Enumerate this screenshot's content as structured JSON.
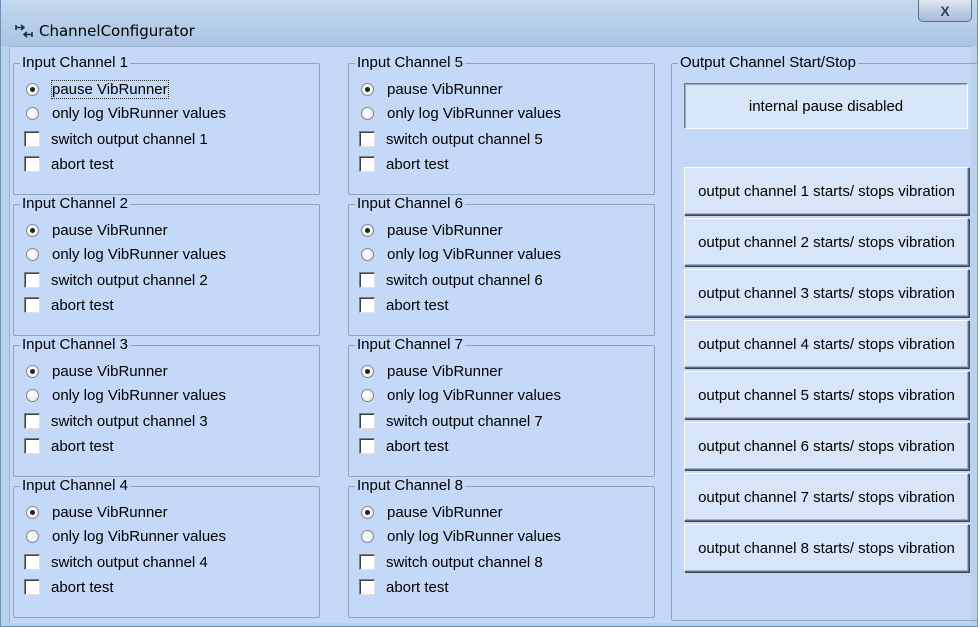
{
  "window": {
    "title": "ChannelConfigurator",
    "close_label": "X"
  },
  "input_channels": [
    {
      "title": "Input Channel 1",
      "pause": "pause VibRunner",
      "log": "only log VibRunner values",
      "switch": "switch output channel 1",
      "abort": "abort test",
      "selected": "pause",
      "switch_checked": false,
      "abort_checked": false
    },
    {
      "title": "Input Channel 2",
      "pause": "pause VibRunner",
      "log": "only log VibRunner values",
      "switch": "switch output channel 2",
      "abort": "abort test",
      "selected": "pause",
      "switch_checked": false,
      "abort_checked": false
    },
    {
      "title": "Input Channel 3",
      "pause": "pause VibRunner",
      "log": "only log VibRunner values",
      "switch": "switch output channel 3",
      "abort": "abort test",
      "selected": "pause",
      "switch_checked": false,
      "abort_checked": false
    },
    {
      "title": "Input Channel 4",
      "pause": "pause VibRunner",
      "log": "only log VibRunner values",
      "switch": "switch output channel 4",
      "abort": "abort test",
      "selected": "pause",
      "switch_checked": false,
      "abort_checked": false
    },
    {
      "title": "Input Channel 5",
      "pause": "pause VibRunner",
      "log": "only log VibRunner values",
      "switch": "switch output channel 5",
      "abort": "abort test",
      "selected": "pause",
      "switch_checked": false,
      "abort_checked": false
    },
    {
      "title": "Input Channel 6",
      "pause": "pause VibRunner",
      "log": "only log VibRunner values",
      "switch": "switch output channel 6",
      "abort": "abort test",
      "selected": "pause",
      "switch_checked": false,
      "abort_checked": false
    },
    {
      "title": "Input Channel 7",
      "pause": "pause VibRunner",
      "log": "only log VibRunner values",
      "switch": "switch output channel 7",
      "abort": "abort test",
      "selected": "pause",
      "switch_checked": false,
      "abort_checked": false
    },
    {
      "title": "Input Channel 8",
      "pause": "pause VibRunner",
      "log": "only log VibRunner values",
      "switch": "switch output channel 8",
      "abort": "abort test",
      "selected": "pause",
      "switch_checked": false,
      "abort_checked": false
    }
  ],
  "output_group": {
    "title": "Output Channel Start/Stop",
    "status": "internal pause disabled",
    "buttons": [
      "output channel 1 starts/ stops vibration",
      "output channel 2 starts/ stops vibration",
      "output channel 3 starts/ stops vibration",
      "output channel 4 starts/ stops vibration",
      "output channel 5 starts/ stops vibration",
      "output channel 6 starts/ stops vibration",
      "output channel 7 starts/ stops vibration",
      "output channel 8 starts/ stops vibration"
    ]
  },
  "colors": {
    "window_bg": "#b9d1ea",
    "client_bg": "#c4d9f7",
    "button_bg": "#d7e5f8"
  }
}
